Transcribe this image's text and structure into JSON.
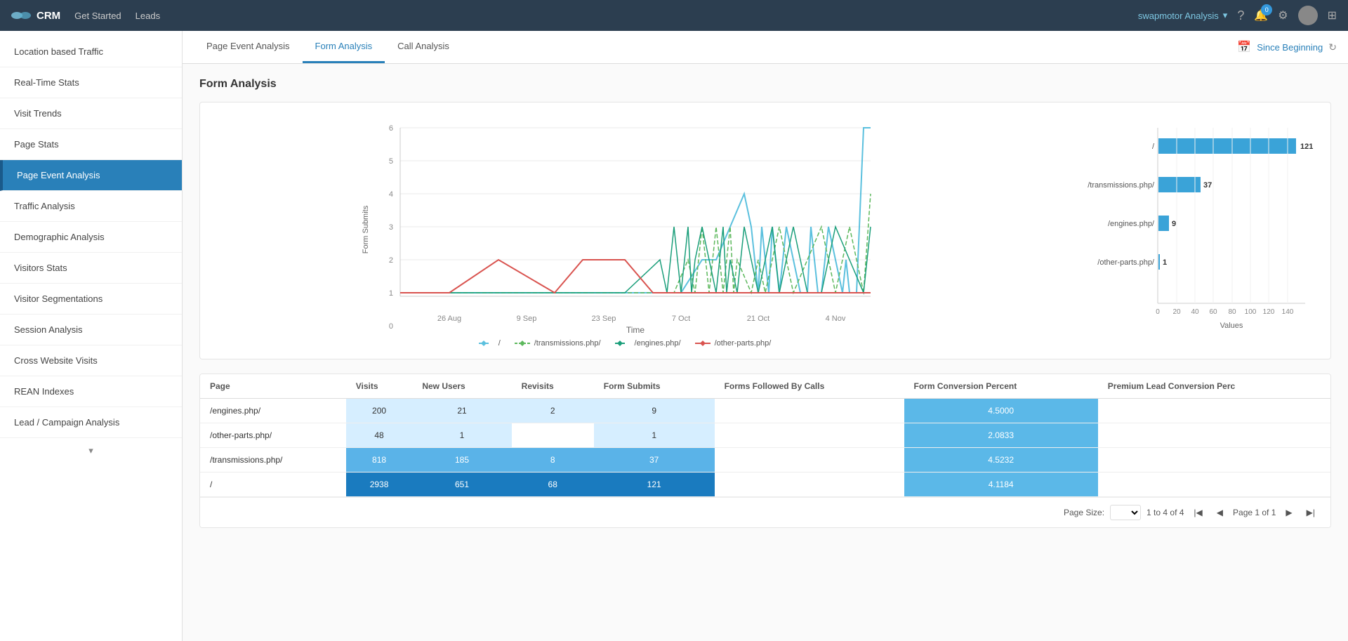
{
  "topnav": {
    "brand": "CRM",
    "links": [
      "Get Started",
      "Leads"
    ],
    "user_label": "swapmotor Analysis",
    "notif_count": "0"
  },
  "sidebar": {
    "items": [
      {
        "id": "location-based-traffic",
        "label": "Location based Traffic",
        "active": false
      },
      {
        "id": "real-time-stats",
        "label": "Real-Time Stats",
        "active": false
      },
      {
        "id": "visit-trends",
        "label": "Visit Trends",
        "active": false
      },
      {
        "id": "page-stats",
        "label": "Page Stats",
        "active": false
      },
      {
        "id": "page-event-analysis",
        "label": "Page Event Analysis",
        "active": true
      },
      {
        "id": "traffic-analysis",
        "label": "Traffic Analysis",
        "active": false
      },
      {
        "id": "demographic-analysis",
        "label": "Demographic Analysis",
        "active": false
      },
      {
        "id": "visitors-stats",
        "label": "Visitors Stats",
        "active": false
      },
      {
        "id": "visitor-segmentations",
        "label": "Visitor Segmentations",
        "active": false
      },
      {
        "id": "session-analysis",
        "label": "Session Analysis",
        "active": false
      },
      {
        "id": "cross-website-visits",
        "label": "Cross Website Visits",
        "active": false
      },
      {
        "id": "rean-indexes",
        "label": "REAN Indexes",
        "active": false
      },
      {
        "id": "lead-campaign-analysis",
        "label": "Lead / Campaign Analysis",
        "active": false
      }
    ]
  },
  "subtabs": {
    "tabs": [
      {
        "id": "page-event-analysis",
        "label": "Page Event Analysis",
        "active": false
      },
      {
        "id": "form-analysis",
        "label": "Form Analysis",
        "active": true
      },
      {
        "id": "call-analysis",
        "label": "Call Analysis",
        "active": false
      }
    ],
    "date_filter": "Since Beginning"
  },
  "content": {
    "section_title": "Form Analysis",
    "chart": {
      "y_axis_label": "Form Submits",
      "x_axis_label": "Time",
      "y_ticks": [
        "0",
        "1",
        "2",
        "3",
        "4",
        "5",
        "6"
      ],
      "x_ticks": [
        "26 Aug",
        "9 Sep",
        "23 Sep",
        "7 Oct",
        "21 Oct",
        "4 Nov"
      ],
      "legend": [
        {
          "key": "/",
          "color": "#5bc0de"
        },
        {
          "key": "/transmissions.php/",
          "color": "#5cb85c"
        },
        {
          "key": "/engines.php/",
          "color": "#5cb85c"
        },
        {
          "key": "/other-parts.php/",
          "color": "#d9534f"
        }
      ]
    },
    "bar_chart": {
      "title": "Values",
      "bars": [
        {
          "label": "/",
          "value": 121,
          "max": 140
        },
        {
          "label": "/transmissions.php/",
          "value": 37,
          "max": 140
        },
        {
          "label": "/engines.php/",
          "value": 9,
          "max": 140
        },
        {
          "label": "/other-parts.php/",
          "value": 1,
          "max": 140
        }
      ],
      "x_axis_ticks": [
        "0",
        "20",
        "40",
        "60",
        "80",
        "100",
        "120",
        "140"
      ]
    },
    "table": {
      "columns": [
        "Page",
        "Visits",
        "New Users",
        "Revisits",
        "Form Submits",
        "Forms Followed By Calls",
        "Form Conversion Percent",
        "Premium Lead Conversion Perc"
      ],
      "rows": [
        {
          "page": "/engines.php/",
          "visits": "200",
          "new_users": "21",
          "revisits": "2",
          "form_submits": "9",
          "forms_followed": "",
          "form_conv": "4.5000",
          "premium_conv": ""
        },
        {
          "page": "/other-parts.php/",
          "visits": "48",
          "new_users": "1",
          "revisits": "",
          "form_submits": "1",
          "forms_followed": "",
          "form_conv": "2.0833",
          "premium_conv": ""
        },
        {
          "page": "/transmissions.php/",
          "visits": "818",
          "new_users": "185",
          "revisits": "8",
          "form_submits": "37",
          "forms_followed": "",
          "form_conv": "4.5232",
          "premium_conv": ""
        },
        {
          "page": "/",
          "visits": "2938",
          "new_users": "651",
          "revisits": "68",
          "form_submits": "121",
          "forms_followed": "",
          "form_conv": "4.1184",
          "premium_conv": ""
        }
      ]
    },
    "pagination": {
      "page_size_label": "Page Size:",
      "range": "1 to 4 of 4",
      "page_label": "Page 1 of 1"
    }
  }
}
